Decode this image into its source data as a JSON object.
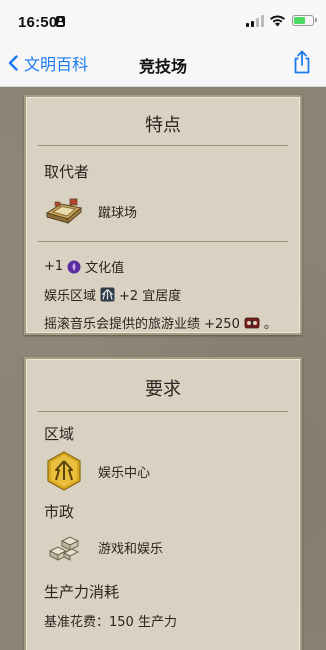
{
  "status_bar": {
    "time": "16:50"
  },
  "nav": {
    "back_label": "文明百科",
    "title": "竞技场"
  },
  "features": {
    "header": "特点",
    "replaced_by_label": "取代者",
    "replaced_by_item": "蹴球场",
    "culture_amount": "+1",
    "culture_label": "文化值",
    "entertainment_district": "娱乐区域",
    "amenities_text": "+2 宜居度",
    "tourism_text_prefix": "摇滚音乐会提供的旅游业绩 +250",
    "tourism_text_suffix": "。"
  },
  "requirements": {
    "header": "要求",
    "district_label": "区域",
    "district_item": "娱乐中心",
    "civic_label": "市政",
    "civic_item": "游戏和娱乐",
    "production_label": "生产力消耗",
    "cost_text": "基准花费：150 生产力"
  },
  "colors": {
    "background": "#8b8373",
    "panel": "#d9d2c3",
    "link": "#1a7bf2",
    "district_gold": "#d9a91e",
    "culture_purple": "#6b3bb0"
  }
}
